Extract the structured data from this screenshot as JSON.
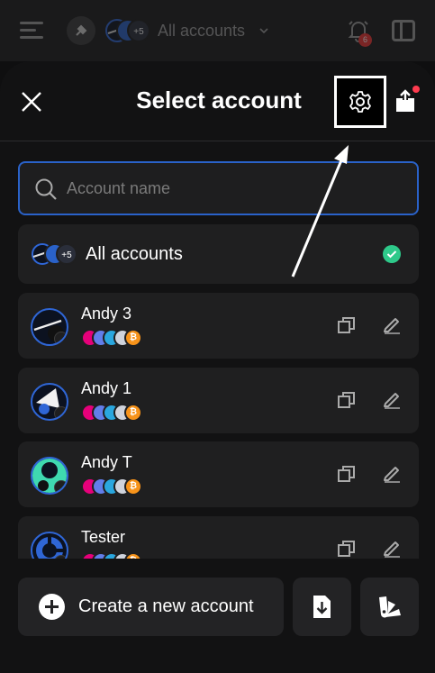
{
  "topbar": {
    "account_label": "All accounts",
    "avatars_badge": "+5",
    "notification_count": "6",
    "icons": [
      "menu-icon",
      "network-icon",
      "chevron-down-icon",
      "bell-icon",
      "sidebar-panel-icon"
    ]
  },
  "sheet": {
    "title": "Select account",
    "search": {
      "placeholder": "Account name",
      "value": ""
    },
    "all_accounts": {
      "label": "All accounts",
      "avatars_badge": "+5",
      "selected": true
    },
    "accounts": [
      {
        "name": "Andy 3"
      },
      {
        "name": "Andy 1"
      },
      {
        "name": "Andy T"
      },
      {
        "name": "Tester"
      }
    ],
    "chain_icons": [
      "polkadot-icon",
      "ethereum-icon",
      "ton-icon",
      "cosmos-icon",
      "bitcoin-icon"
    ],
    "create_button_label": "Create a new account"
  },
  "colors": {
    "accent_blue": "#2a62c9",
    "check_green": "#2ec98a",
    "badge_red": "#e33333",
    "polkadot": "#e6007a",
    "ethereum": "#627eea",
    "ton": "#2aa7df",
    "bitcoin": "#f7931a"
  }
}
